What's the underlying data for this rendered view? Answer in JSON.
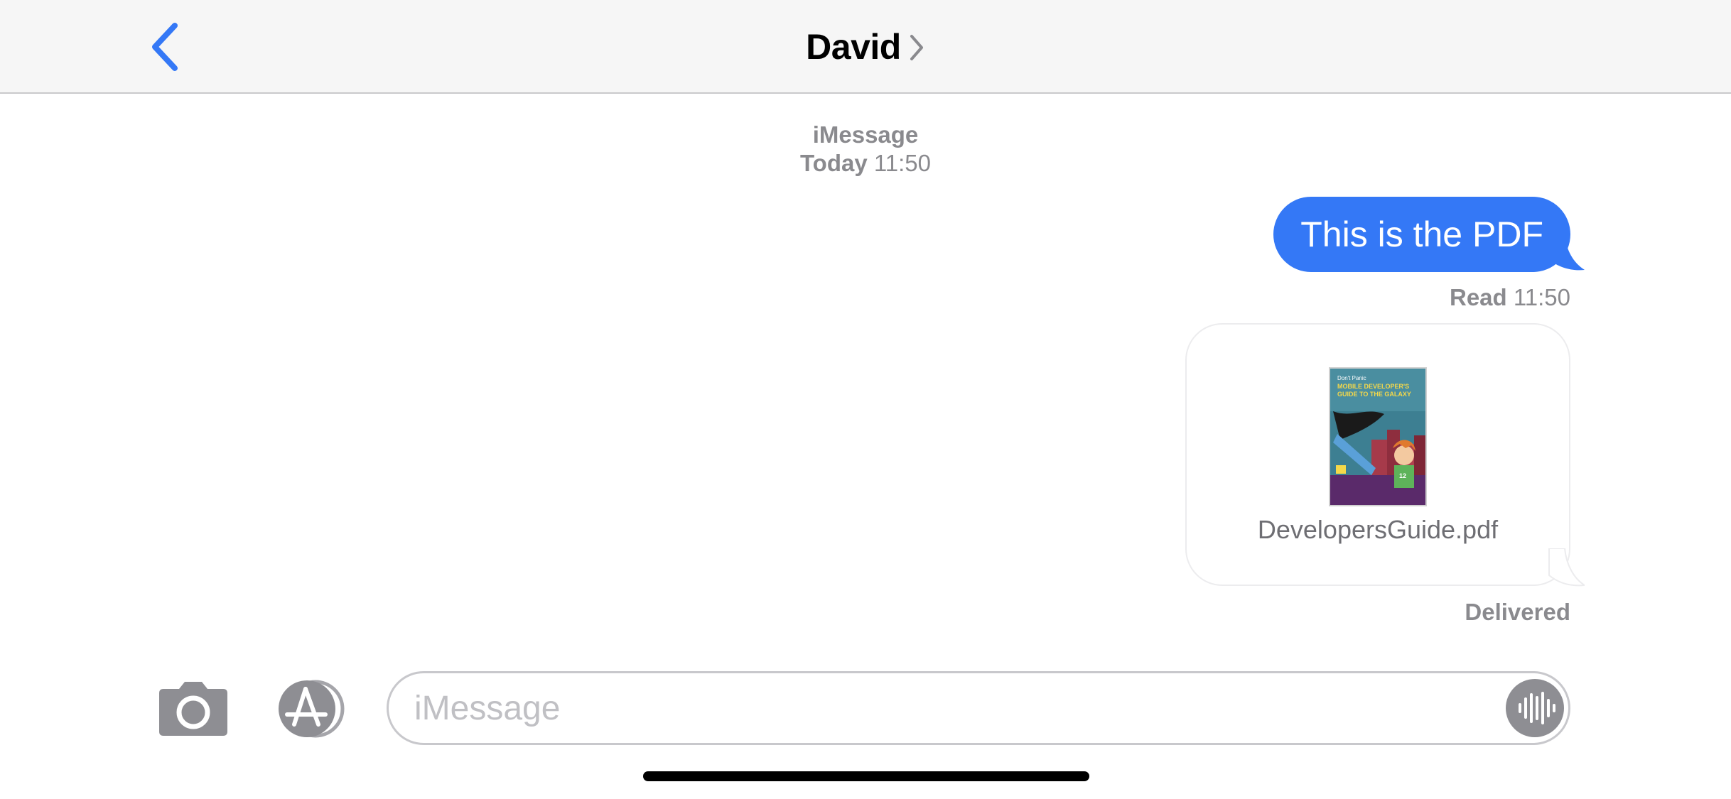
{
  "header": {
    "contact_name": "David",
    "back_icon": "chevron-left-icon",
    "detail_icon": "chevron-right-icon"
  },
  "conversation": {
    "service": "iMessage",
    "day": "Today",
    "time": "11:50",
    "messages": [
      {
        "direction": "outgoing",
        "text": "This is the PDF",
        "status_label": "Read",
        "status_time": "11:50"
      },
      {
        "direction": "outgoing",
        "type": "attachment",
        "file_name": "DevelopersGuide.pdf",
        "cover_text": {
          "line1": "Don't Panic",
          "line2": "MOBILE DEVELOPER'S",
          "line3": "GUIDE TO THE GALAXY",
          "badge": "12"
        },
        "status_label": "Delivered"
      }
    ]
  },
  "composer": {
    "placeholder": "iMessage",
    "camera_icon": "camera-icon",
    "apps_icon": "app-store-icon",
    "audio_icon": "audio-waveform-icon"
  },
  "colors": {
    "accent": "#3478f6",
    "header_bg": "#f6f6f6",
    "meta_text": "#8a8a8e"
  }
}
